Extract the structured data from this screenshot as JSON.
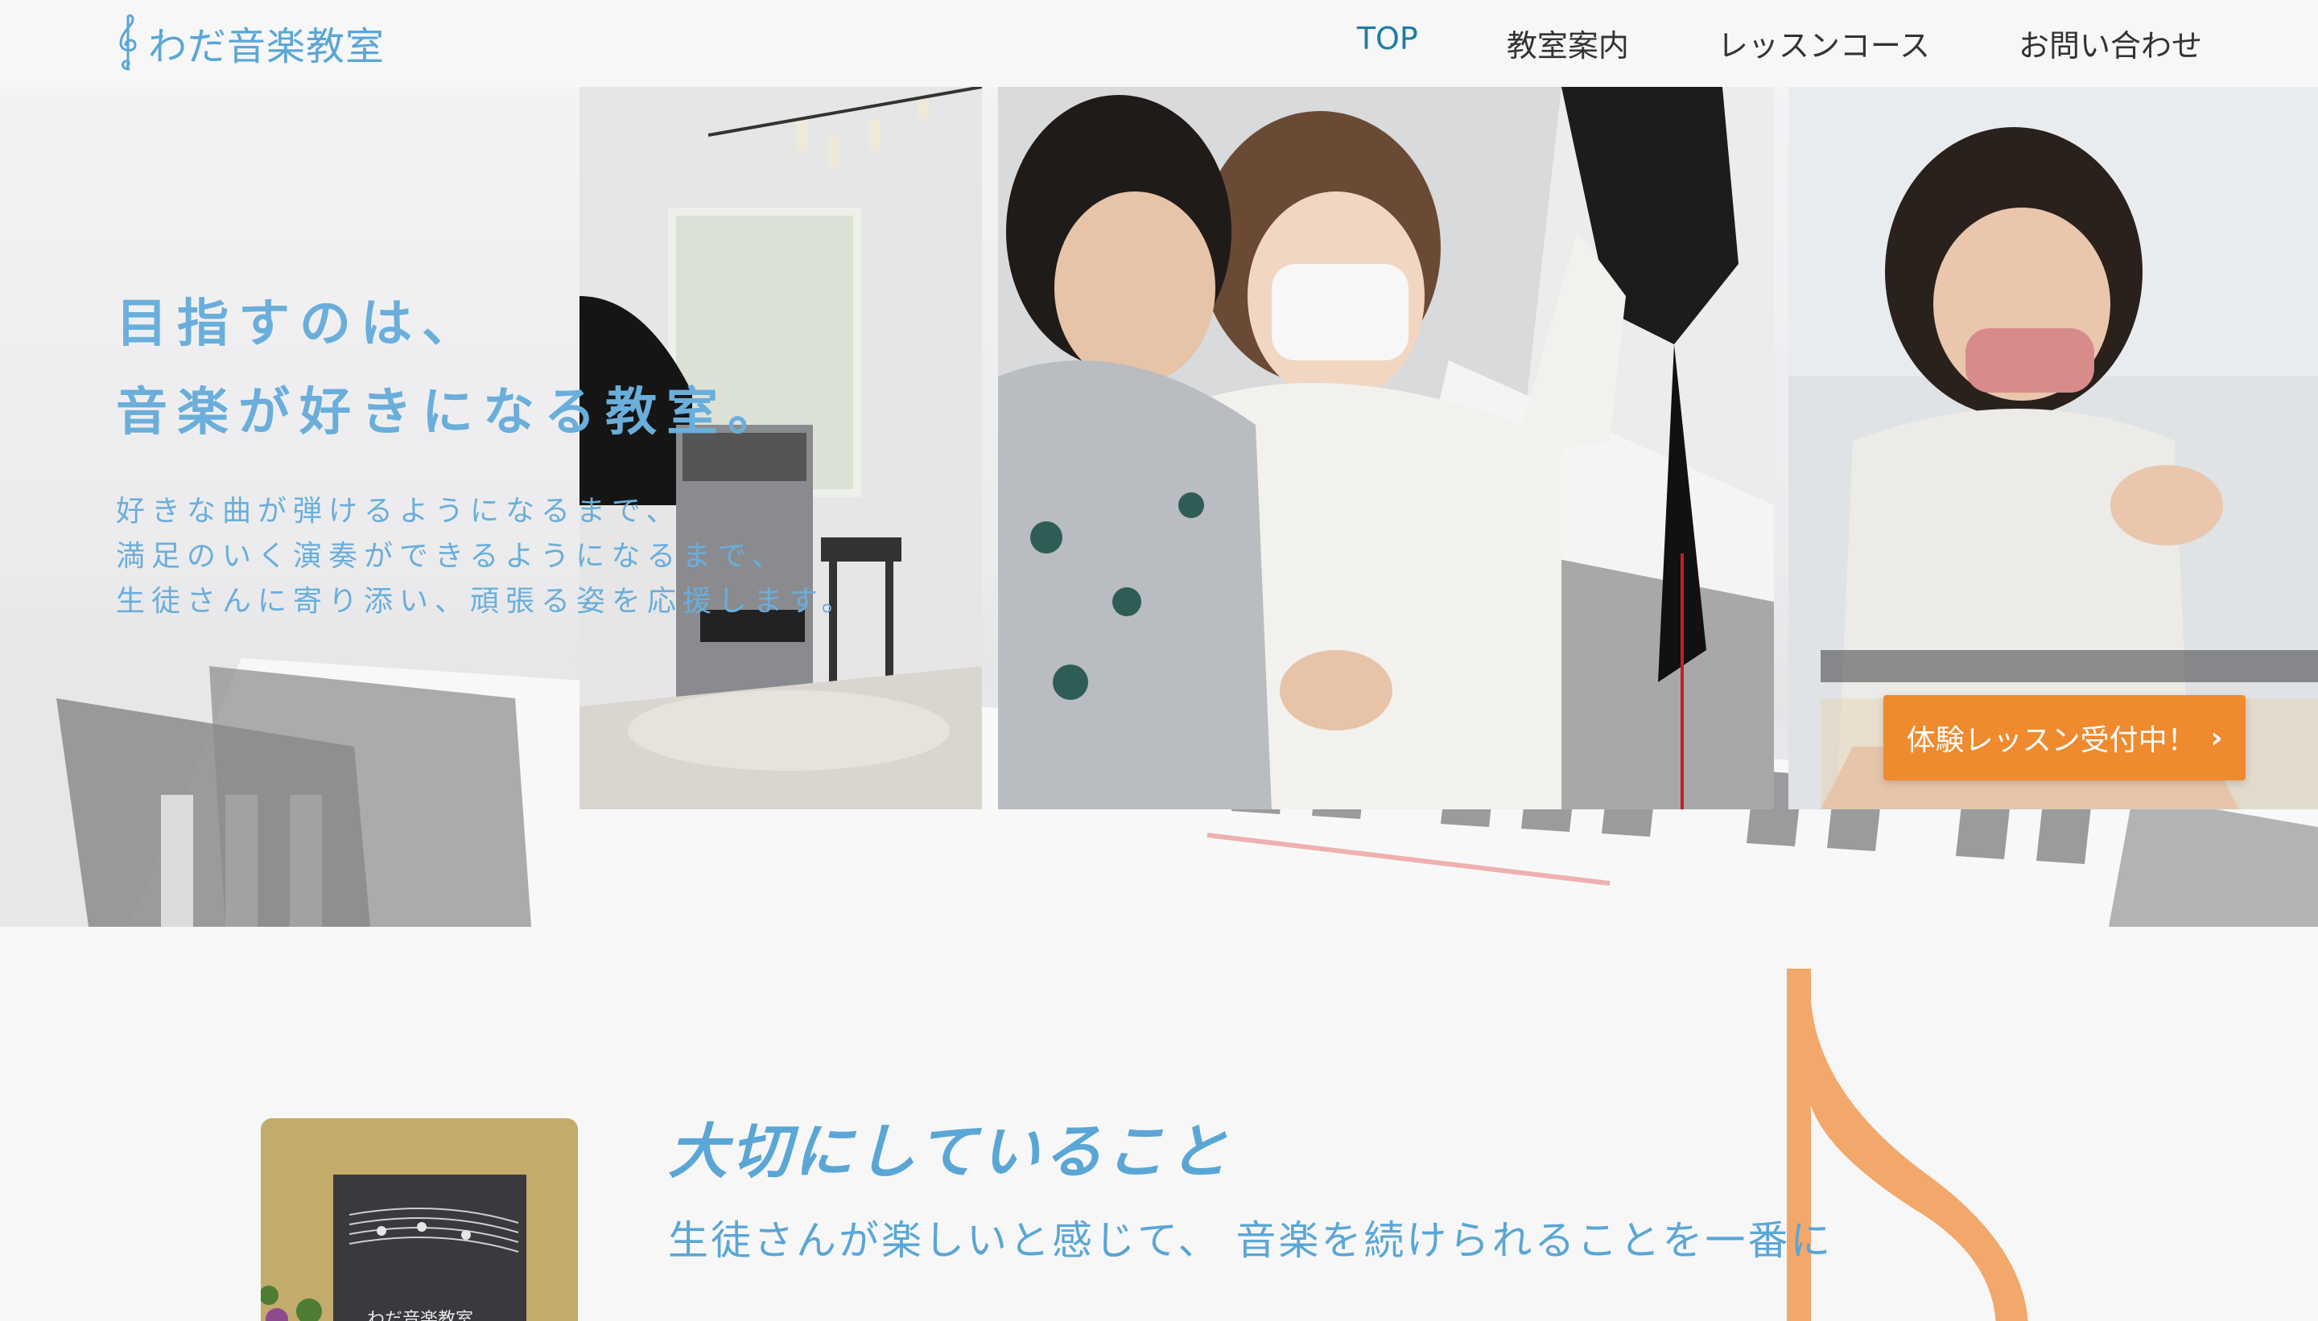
{
  "header": {
    "logo_text": "わだ音楽教室",
    "nav": [
      {
        "label": "TOP"
      },
      {
        "label": "教室案内"
      },
      {
        "label": "レッスンコース"
      },
      {
        "label": "お問い合わせ"
      }
    ]
  },
  "hero": {
    "title_line1": "目指すのは、",
    "title_line2": "音楽が好きになる教室。",
    "desc_line1": "好きな曲が弾けるようになるまで、",
    "desc_line2": "満足のいく演奏ができるようになるまで、",
    "desc_line3": "生徒さんに寄り添い、頑張る姿を応援します。",
    "cta_label": "体験レッスン受付中！"
  },
  "section": {
    "sign_text": "わだ音楽教室",
    "title": "大切にしていること",
    "subtitle": "生徒さんが楽しいと感じて、 音楽を続けられることを一番に"
  },
  "colors": {
    "accent_blue": "#5aa6d6",
    "nav_active": "#1f7da3",
    "cta_orange": "#ef8a2e",
    "note_orange": "#f2a86a"
  }
}
